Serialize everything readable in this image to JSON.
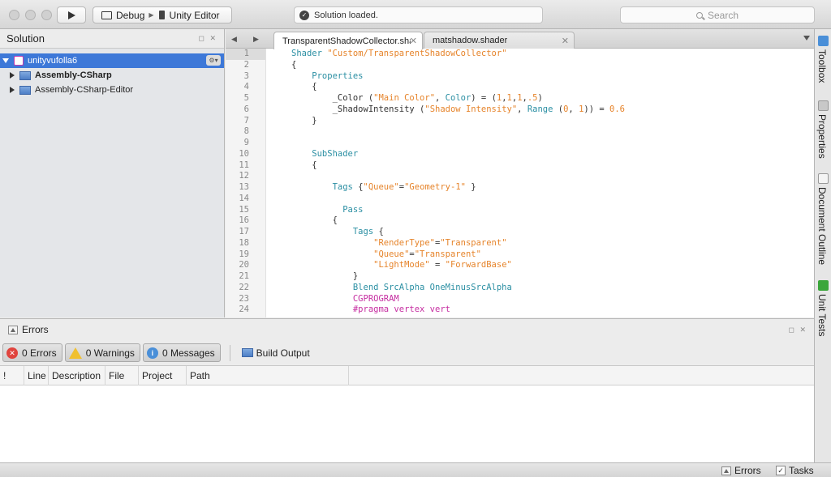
{
  "toolbar": {
    "config": "Debug",
    "target": "Unity Editor",
    "status": "Solution loaded.",
    "search_placeholder": "Search"
  },
  "solution": {
    "title": "Solution",
    "root": "unityvufolla6",
    "projects": [
      {
        "label": "Assembly-CSharp",
        "bold": true
      },
      {
        "label": "Assembly-CSharp-Editor",
        "bold": false
      }
    ]
  },
  "editor": {
    "tabs": [
      {
        "label": "TransparentShadowCollector.shader",
        "active": true
      },
      {
        "label": "matshadow.shader",
        "active": false
      }
    ],
    "current_line": 1,
    "lines": [
      [
        [
          "kw",
          "Shader "
        ],
        [
          "str",
          "\"Custom/TransparentShadowCollector\""
        ]
      ],
      [
        [
          "pl",
          "{"
        ]
      ],
      [
        [
          "kw",
          "    Properties"
        ]
      ],
      [
        [
          "pl",
          "    {"
        ]
      ],
      [
        [
          "pl",
          "        _Color ("
        ],
        [
          "str",
          "\"Main Color\""
        ],
        [
          "pl",
          ", "
        ],
        [
          "kw",
          "Color"
        ],
        [
          "pl",
          ") = ("
        ],
        [
          "num",
          "1"
        ],
        [
          "pl",
          ","
        ],
        [
          "num",
          "1"
        ],
        [
          "pl",
          ","
        ],
        [
          "num",
          "1"
        ],
        [
          "pl",
          ","
        ],
        [
          "num",
          ".5"
        ],
        [
          "pl",
          ")"
        ]
      ],
      [
        [
          "pl",
          "        _ShadowIntensity ("
        ],
        [
          "str",
          "\"Shadow Intensity\""
        ],
        [
          "pl",
          ", "
        ],
        [
          "kw",
          "Range"
        ],
        [
          "pl",
          " ("
        ],
        [
          "num",
          "0"
        ],
        [
          "pl",
          ", "
        ],
        [
          "num",
          "1"
        ],
        [
          "pl",
          ")) = "
        ],
        [
          "num",
          "0.6"
        ]
      ],
      [
        [
          "pl",
          "    }"
        ]
      ],
      [
        [
          "pl",
          ""
        ]
      ],
      [
        [
          "pl",
          ""
        ]
      ],
      [
        [
          "kw",
          "    SubShader"
        ]
      ],
      [
        [
          "pl",
          "    {"
        ]
      ],
      [
        [
          "pl",
          ""
        ]
      ],
      [
        [
          "kw",
          "        Tags "
        ],
        [
          "pl",
          "{"
        ],
        [
          "str",
          "\"Queue\""
        ],
        [
          "pl",
          "="
        ],
        [
          "str",
          "\"Geometry-1\""
        ],
        [
          "pl",
          " }"
        ]
      ],
      [
        [
          "pl",
          ""
        ]
      ],
      [
        [
          "kw",
          "          Pass"
        ]
      ],
      [
        [
          "pl",
          "        {"
        ]
      ],
      [
        [
          "kw",
          "            Tags "
        ],
        [
          "pl",
          "{"
        ]
      ],
      [
        [
          "str",
          "                \"RenderType\""
        ],
        [
          "pl",
          "="
        ],
        [
          "str",
          "\"Transparent\""
        ]
      ],
      [
        [
          "str",
          "                \"Queue\""
        ],
        [
          "pl",
          "="
        ],
        [
          "str",
          "\"Transparent\""
        ]
      ],
      [
        [
          "str",
          "                \"LightMode\""
        ],
        [
          "pl",
          " = "
        ],
        [
          "str",
          "\"ForwardBase\""
        ]
      ],
      [
        [
          "pl",
          "            }"
        ]
      ],
      [
        [
          "kw",
          "            Blend SrcAlpha OneMinusSrcAlpha"
        ]
      ],
      [
        [
          "cg",
          "            CGPROGRAM"
        ]
      ],
      [
        [
          "cg",
          "            #pragma vertex vert"
        ]
      ]
    ]
  },
  "dock": {
    "items": [
      {
        "label": "Toolbox",
        "icon": "toolbox-icon",
        "color": "#4a8fd8"
      },
      {
        "label": "Properties",
        "icon": "properties-icon",
        "color": "#9a9a9a"
      },
      {
        "label": "Document Outline",
        "icon": "document-outline-icon",
        "color": "#9a9a9a"
      },
      {
        "label": "Unit Tests",
        "icon": "unit-tests-icon",
        "color": "#3aa63a"
      }
    ]
  },
  "errors": {
    "title": "Errors",
    "errors_btn": "0 Errors",
    "warnings_btn": "0 Warnings",
    "messages_btn": "0 Messages",
    "build_output": "Build Output",
    "columns": [
      {
        "label": "!",
        "width": 30
      },
      {
        "label": "Line",
        "width": 30
      },
      {
        "label": "Description",
        "width": 70
      },
      {
        "label": "File",
        "width": 41
      },
      {
        "label": "Project",
        "width": 59
      },
      {
        "label": "Path",
        "width": 200
      }
    ]
  },
  "bottom_status": {
    "errors": "Errors",
    "tasks": "Tasks"
  }
}
